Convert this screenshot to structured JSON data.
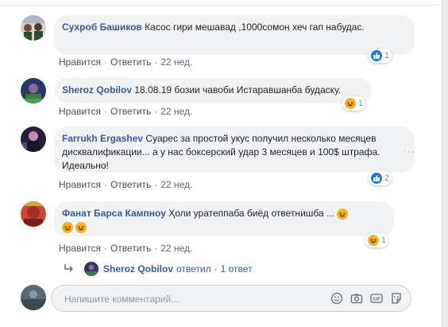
{
  "comments": [
    {
      "author": "Сухроб Башиков",
      "text": "Касос гири мешавад ,1000сомон хеч гап набудас.",
      "like_label": "Нравится",
      "reply_label": "Ответить",
      "time": "22 нед.",
      "reaction": "like-icon",
      "reaction_count": "1"
    },
    {
      "author": "Sheroz Qobilov",
      "text": "18.08.19 бозии чавоби Истаравшанба будаску.",
      "like_label": "Нравится",
      "reply_label": "Ответить",
      "time": "22 нед.",
      "reaction": "haha-icon",
      "reaction_count": "1"
    },
    {
      "author": "Farrukh Ergashev",
      "text": "Суарес за простой укус получил несколько месяцев дисквалификации... а у нас боксерский удар 3 месяцев и 100$ штрафа. Идеально!",
      "like_label": "Нравится",
      "reply_label": "Ответить",
      "time": "22 нед.",
      "reaction": "like-icon",
      "reaction_count": "2",
      "more": "···"
    },
    {
      "author": "Фанат Барса Кампноу",
      "text": "Ҳоли уратеппаба биёд ответнишба ...",
      "like_label": "Нравится",
      "reply_label": "Ответить",
      "time": "22 нед.",
      "reaction": "haha-icon",
      "reaction_count": "1"
    }
  ],
  "reply_summary": {
    "author": "Sheroz Qobilov",
    "action": "ответил",
    "count": "1 ответ"
  },
  "composer": {
    "placeholder": "Напишите комментарий...",
    "icons": [
      "emoji-icon",
      "camera-icon",
      "gif-icon",
      "sticker-icon"
    ]
  },
  "colors": {
    "link": "#385898",
    "meta": "#606770",
    "bubble": "#f2f3f5",
    "like_blue": "#1877f2",
    "haha_yellow": "#f7b125"
  }
}
